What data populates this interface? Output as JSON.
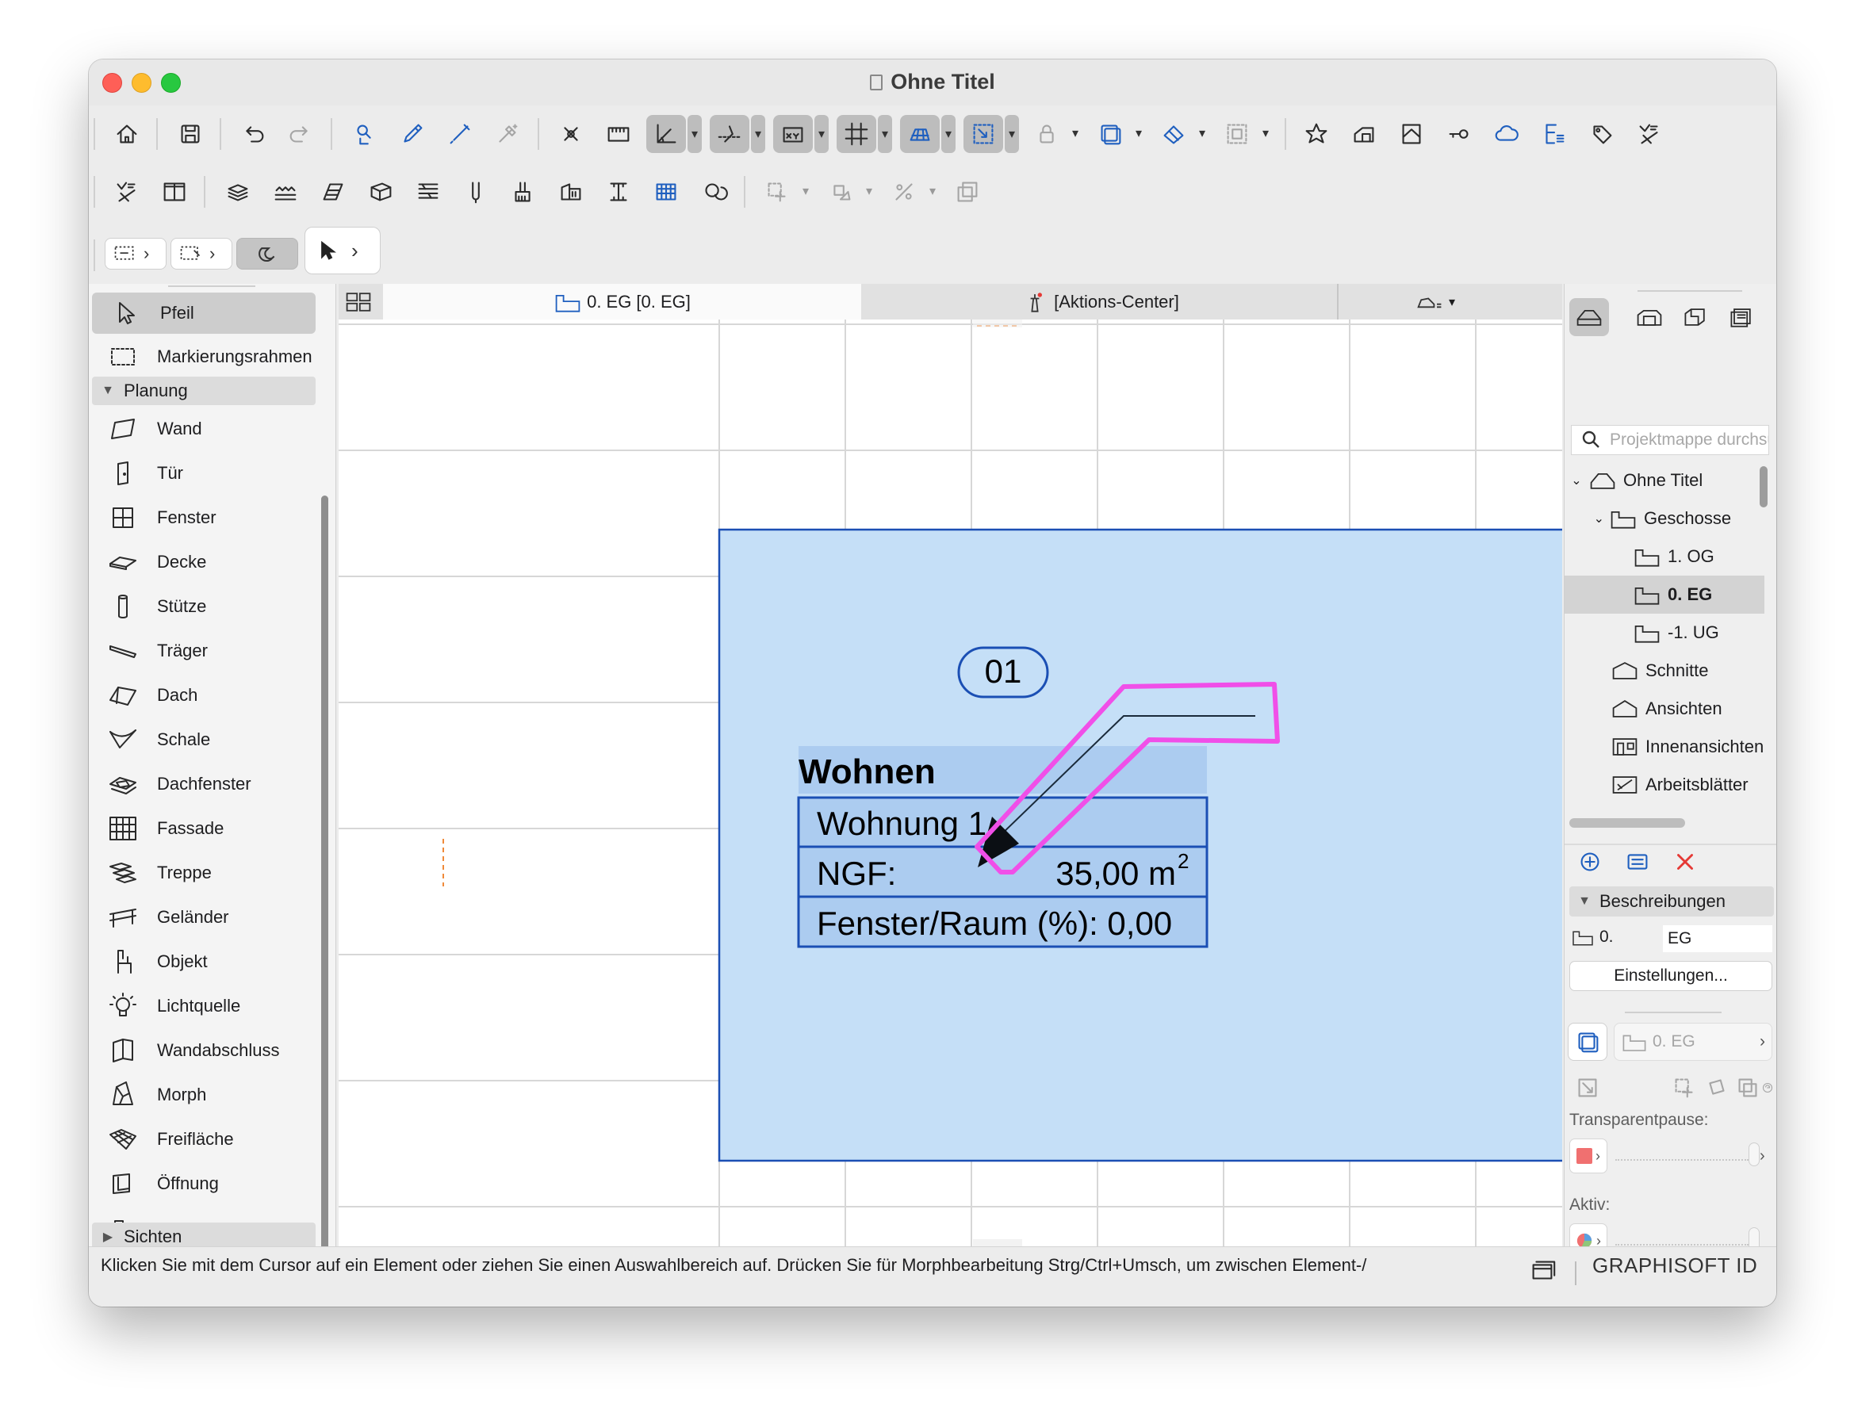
{
  "window": {
    "title": "Ohne Titel"
  },
  "toolbox": {
    "tools_top": [
      {
        "label": "Pfeil",
        "icon": "arrow-pointer-icon"
      },
      {
        "label": "Markierungsrahmen",
        "icon": "marquee-icon"
      }
    ],
    "group_planung": "Planung",
    "tools": [
      {
        "label": "Wand",
        "icon": "wall-icon"
      },
      {
        "label": "Tür",
        "icon": "door-icon"
      },
      {
        "label": "Fenster",
        "icon": "window-icon"
      },
      {
        "label": "Decke",
        "icon": "slab-icon"
      },
      {
        "label": "Stütze",
        "icon": "column-icon"
      },
      {
        "label": "Träger",
        "icon": "beam-icon"
      },
      {
        "label": "Dach",
        "icon": "roof-icon"
      },
      {
        "label": "Schale",
        "icon": "shell-icon"
      },
      {
        "label": "Dachfenster",
        "icon": "skylight-icon"
      },
      {
        "label": "Fassade",
        "icon": "curtain-wall-icon"
      },
      {
        "label": "Treppe",
        "icon": "stair-icon"
      },
      {
        "label": "Geländer",
        "icon": "railing-icon"
      },
      {
        "label": "Objekt",
        "icon": "object-icon"
      },
      {
        "label": "Lichtquelle",
        "icon": "lamp-icon"
      },
      {
        "label": "Wandabschluss",
        "icon": "wall-end-icon"
      },
      {
        "label": "Morph",
        "icon": "morph-icon"
      },
      {
        "label": "Freifläche",
        "icon": "mesh-icon"
      },
      {
        "label": "Öffnung",
        "icon": "opening-icon"
      }
    ],
    "group_sichten": "Sichten"
  },
  "tabs": {
    "floor_tab": "0. EG [0. EG]",
    "action_center_tab": "[Aktions-Center]"
  },
  "drawing": {
    "zone_number": "01",
    "zone_name": "Wohnen",
    "row1": "Wohnung 1",
    "row2_label": "NGF:",
    "row2_value": "35,00 m",
    "row2_unit_sup": "2",
    "row3": "Fenster/Raum (%): 0,00",
    "zone_fill": "#c5dff7",
    "zone_stroke": "#1b4fb4",
    "highlight_color": "#f04fe8"
  },
  "navigator": {
    "search_placeholder": "Projektmappe durchsuchen",
    "tree": [
      {
        "label": "Ohne Titel"
      },
      {
        "label": "Geschosse"
      },
      {
        "label": "1. OG"
      },
      {
        "label": "0. EG"
      },
      {
        "label": "-1. UG"
      },
      {
        "label": "Schnitte"
      },
      {
        "label": "Ansichten"
      },
      {
        "label": "Innenansichten"
      },
      {
        "label": "Arbeitsblätter"
      }
    ],
    "section_title": "Beschreibungen",
    "id_label": "0.",
    "id_value": "EG",
    "settings_button": "Einstellungen...",
    "view_field": "0. EG",
    "transparent_label": "Transparentpause:",
    "active_label": "Aktiv:"
  },
  "statusbar": {
    "text": "Klicken Sie mit dem Cursor auf ein Element oder ziehen Sie einen Auswahlbereich auf. Drücken Sie für Morphbearbeitung Strg/Ctrl+Umsch, um zwischen Element-/",
    "brand": "GRAPHISOFT ID"
  }
}
